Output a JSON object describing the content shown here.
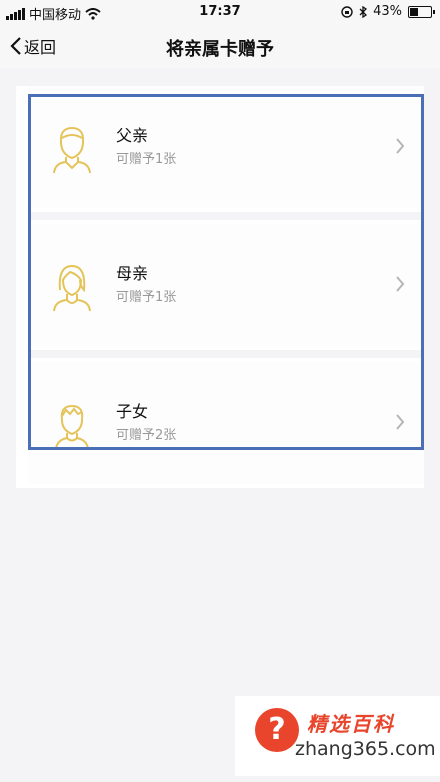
{
  "status_bar": {
    "carrier": "中国移动",
    "time": "17:37",
    "battery": "43%",
    "battery_level": 0.43
  },
  "nav": {
    "back_label": "返回",
    "title": "将亲属卡赠予"
  },
  "items": [
    {
      "name": "父亲",
      "sub": "可赠予1张",
      "icon": "father-avatar-icon"
    },
    {
      "name": "母亲",
      "sub": "可赠予1张",
      "icon": "mother-avatar-icon"
    },
    {
      "name": "子女",
      "sub": "可赠予2张",
      "icon": "child-avatar-icon"
    }
  ],
  "watermark": {
    "title": "精选百科",
    "site": "zhang365.com",
    "mark": "?"
  },
  "colors": {
    "icon": "#e4c45a",
    "highlight": "#4a6fb7",
    "watermark_accent": "#e8452c"
  }
}
